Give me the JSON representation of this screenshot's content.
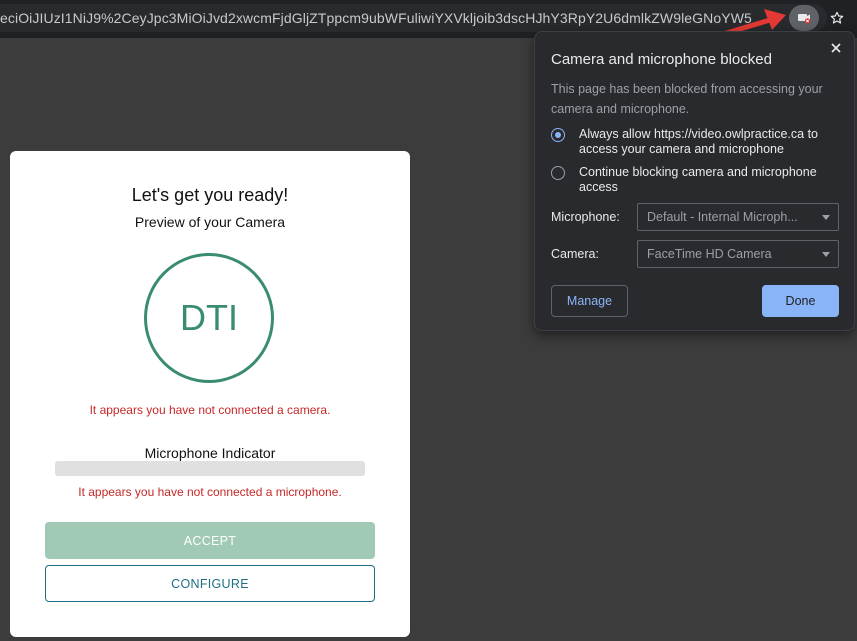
{
  "browser": {
    "url_text": "eciOiJIUzI1NiJ9%2CeyJpc3MiOiJvd2xwcmFjdGljZTppcm9ubWFuliwiYXVkljoib3dscHJhY3RpY2U6dmlkZW9leGNoYW5",
    "camera_icon": "camera-blocked-icon",
    "star_icon": "star-icon",
    "annotation_color": "#e53935"
  },
  "popup": {
    "title": "Camera and microphone blocked",
    "description": "This page has been blocked from accessing your camera and microphone.",
    "options": [
      {
        "label": "Always allow https://video.owlpractice.ca to access your camera and microphone",
        "checked": true
      },
      {
        "label": "Continue blocking camera and microphone access",
        "checked": false
      }
    ],
    "microphone_label": "Microphone:",
    "microphone_value": "Default - Internal Microph...",
    "camera_label": "Camera:",
    "camera_value": "FaceTime HD Camera",
    "manage_label": "Manage",
    "done_label": "Done"
  },
  "card": {
    "title": "Let's get you ready!",
    "subtitle": "Preview of your Camera",
    "avatar_initials": "DTI",
    "camera_error": "It appears you have not connected a camera.",
    "mic_label": "Microphone Indicator",
    "mic_level": 0,
    "mic_error": "It appears you have not connected a microphone.",
    "accept_label": "ACCEPT",
    "configure_label": "CONFIGURE"
  },
  "colors": {
    "accent_green": "#3a8c6e",
    "error_red": "#c62828",
    "chrome_blue": "#8ab4f8"
  }
}
